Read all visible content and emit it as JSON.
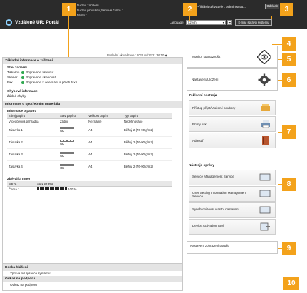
{
  "header": {
    "device_lines": [
      "Název zařízení :",
      "Název produktu(Sériové číslo) :",
      "Místo :"
    ],
    "user_label": "Přihlásit uživatele :",
    "user_name": "Administrat...",
    "logout_label": "Odhlásit",
    "portal_title": "Vzdálené UR: Portál",
    "language_label": "Language:",
    "language_value": "Czech",
    "email_label": "E-mail správci systému"
  },
  "updated_label": "Poslední aktualizace : 2022 04/22 21:36:10",
  "device_info": {
    "title": "Základní informace o zařízení",
    "status_title": "Stav zařízení",
    "rows": [
      {
        "label": "Tiskárna",
        "status": "Připraveno tisknout."
      },
      {
        "label": "Skener",
        "status": "Připraveno skenovat."
      },
      {
        "label": "Fax",
        "status": "Připraveno k odesílání a příjetí faxů."
      }
    ],
    "error_title": "Chybové informace",
    "error_text": "Žádné chyby."
  },
  "consumables": {
    "title": "Informace o spotřebním materiálu",
    "paper_title": "Informace o papíru",
    "columns": [
      "Zdroj papíru",
      "Stav papíru",
      "Velikost papíru",
      "Typ papíru"
    ],
    "rows": [
      {
        "source": "Víceúčelová přihrádka",
        "state": "Žádný",
        "size": "Neznámé",
        "type": "Nedefinováno"
      },
      {
        "source": "Zásuvka 1",
        "state": "OK",
        "size": "A4",
        "type": "Běžný 2 (76-90 g/m2)"
      },
      {
        "source": "Zásuvka 2",
        "state": "OK",
        "size": "A4",
        "type": "Běžný 2 (76-90 g/m2)"
      },
      {
        "source": "Zásuvka 3",
        "state": "OK",
        "size": "A4",
        "type": "Běžný 2 (76-90 g/m2)"
      },
      {
        "source": "Zásuvka 4",
        "state": "OK",
        "size": "A4",
        "type": "Běžný 2 (76-90 g/m2)"
      }
    ],
    "toner_title": "Zbývající toner",
    "toner_columns": [
      "Barva",
      "Stav toneru"
    ],
    "toner_color": "Černá :",
    "toner_level_text": "100 %",
    "toner_level_fraction": 1.0
  },
  "messages": {
    "board_title": "Deska hlášení",
    "board_text": "Zpráva od správce systému:",
    "support_title": "Odkaz na podporu",
    "support_text": "Odkaz na podporu :"
  },
  "right": {
    "monitor_label": "Monitor stavu/Zrušit",
    "settings_label": "Nastavení/Uložení",
    "tools_title": "Základní nástroje",
    "tools": [
      "Přístup přijat/Uložené soubory",
      "Přímý tisk",
      "Adresář"
    ],
    "mgmt_title": "Nástroje správy",
    "mgmt": [
      "Service Management Service",
      "User Setting Information Management Service",
      "Synchronizovat vlastní nastavení",
      "Device Activation Tool"
    ],
    "portal_note": "Nastavení zobrazení portálu"
  },
  "callouts": [
    "1",
    "2",
    "3",
    "4",
    "5",
    "6",
    "7",
    "8",
    "9",
    "10"
  ],
  "colors": {
    "accent": "#f3a21b",
    "topbar": "#2b2b2b",
    "status_ok": "#2fa84f"
  }
}
